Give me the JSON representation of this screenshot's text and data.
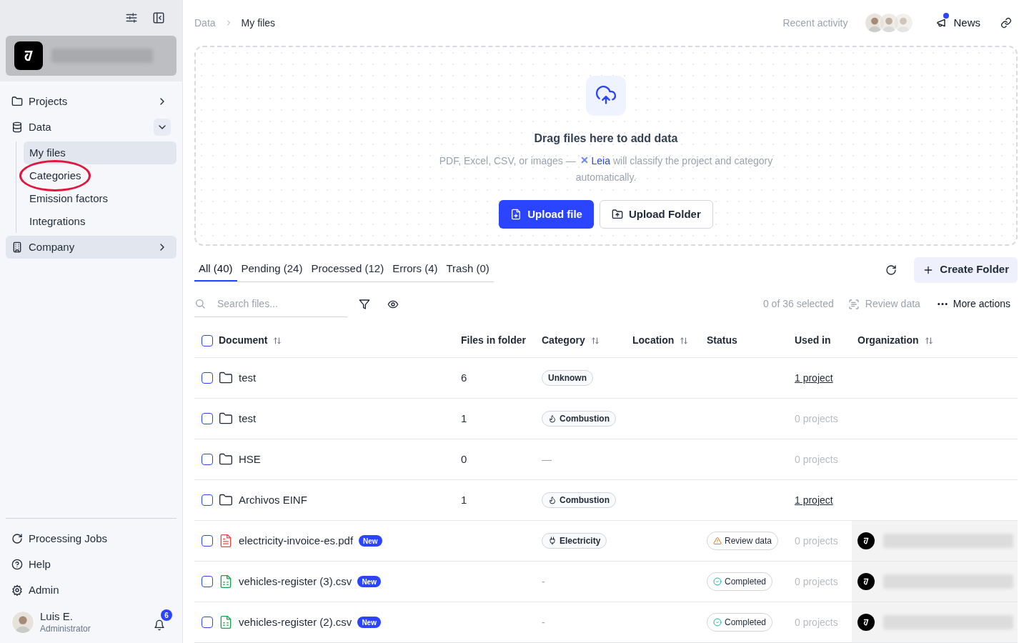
{
  "sidebar": {
    "nav": [
      {
        "label": "Projects",
        "kind": "folder",
        "expanded": false,
        "highlighted": false
      },
      {
        "label": "Data",
        "kind": "database",
        "expanded": true,
        "highlighted": false,
        "children": [
          {
            "label": "My files",
            "selected": true,
            "circled": false
          },
          {
            "label": "Categories",
            "selected": false,
            "circled": true
          },
          {
            "label": "Emission factors",
            "selected": false,
            "circled": false
          },
          {
            "label": "Integrations",
            "selected": false,
            "circled": false
          }
        ]
      },
      {
        "label": "Company",
        "kind": "building",
        "expanded": false,
        "highlighted": true
      }
    ],
    "bottom_nav": [
      {
        "label": "Processing Jobs",
        "kind": "refresh"
      },
      {
        "label": "Help",
        "kind": "help"
      },
      {
        "label": "Admin",
        "kind": "gear"
      }
    ],
    "user": {
      "name": "Luis E.",
      "role": "Administrator",
      "notifications": "6"
    }
  },
  "breadcrumb": [
    "Data",
    "My files"
  ],
  "header": {
    "recent_activity": "Recent activity",
    "news": "News",
    "news_unread": true
  },
  "dropzone": {
    "title": "Drag files here to add data",
    "text_before": "PDF, Excel, CSV, or images — ",
    "link": "Leia",
    "text_after": " will classify the project and category automatically.",
    "buttons": [
      {
        "label": "Upload file",
        "kind": "primary"
      },
      {
        "label": "Upload Folder",
        "kind": "secondary"
      }
    ]
  },
  "tabs": [
    {
      "label": "All (40)",
      "selected": true
    },
    {
      "label": "Pending (24)",
      "selected": false
    },
    {
      "label": "Processed (12)",
      "selected": false
    },
    {
      "label": "Errors (4)",
      "selected": false
    },
    {
      "label": "Trash (0)",
      "selected": false
    }
  ],
  "create_folder": "Create Folder",
  "toolbar": {
    "search_placeholder": "Search files...",
    "selection": "0 of 36 selected",
    "review": "Review data",
    "review_disabled": true,
    "more": "More actions"
  },
  "table": {
    "all_checked": false,
    "columns": [
      {
        "label": "Document",
        "sortable": true
      },
      {
        "label": "Files in folder",
        "sortable": false
      },
      {
        "label": "Category",
        "sortable": true
      },
      {
        "label": "Location",
        "sortable": true
      },
      {
        "label": "Status",
        "sortable": false
      },
      {
        "label": "Used in",
        "sortable": false
      },
      {
        "label": "Organization",
        "sortable": true
      }
    ],
    "rows": [
      {
        "kind": "folder",
        "checked": false,
        "name": "test",
        "new": false,
        "files": "6",
        "category": {
          "label": "Unknown",
          "kind": "plain"
        },
        "used_in": "1 project",
        "used_linked": true,
        "org": false
      },
      {
        "kind": "folder",
        "checked": false,
        "name": "test",
        "new": false,
        "files": "1",
        "category": {
          "label": "Combustion",
          "kind": "flame"
        },
        "used_in": "0 projects",
        "used_linked": false,
        "org": false
      },
      {
        "kind": "folder",
        "checked": false,
        "name": "HSE",
        "new": false,
        "files": "0",
        "category": {
          "label": "—",
          "kind": "empty"
        },
        "used_in": "0 projects",
        "used_linked": false,
        "org": false
      },
      {
        "kind": "folder",
        "checked": false,
        "name": "Archivos EINF",
        "new": false,
        "files": "1",
        "category": {
          "label": "Combustion",
          "kind": "flame"
        },
        "used_in": "1 project",
        "used_linked": true,
        "org": false
      },
      {
        "kind": "pdf",
        "checked": false,
        "name": "electricity-invoice-es.pdf",
        "new": true,
        "new_label": "New",
        "category": {
          "label": "Electricity",
          "kind": "plug"
        },
        "status": {
          "label": "Review data",
          "kind": "review"
        },
        "used_in": "0 projects",
        "used_linked": false,
        "org": true
      },
      {
        "kind": "csv",
        "checked": false,
        "name": "vehicles-register (3).csv",
        "new": true,
        "new_label": "New",
        "category": {
          "label": "-",
          "kind": "empty"
        },
        "status": {
          "label": "Completed",
          "kind": "completed"
        },
        "used_in": "0 projects",
        "used_linked": false,
        "org": true
      },
      {
        "kind": "csv",
        "checked": false,
        "name": "vehicles-register (2).csv",
        "new": true,
        "new_label": "New",
        "category": {
          "label": "-",
          "kind": "empty"
        },
        "status": {
          "label": "Completed",
          "kind": "completed"
        },
        "used_in": "0 projects",
        "used_linked": false,
        "org": true
      }
    ]
  }
}
